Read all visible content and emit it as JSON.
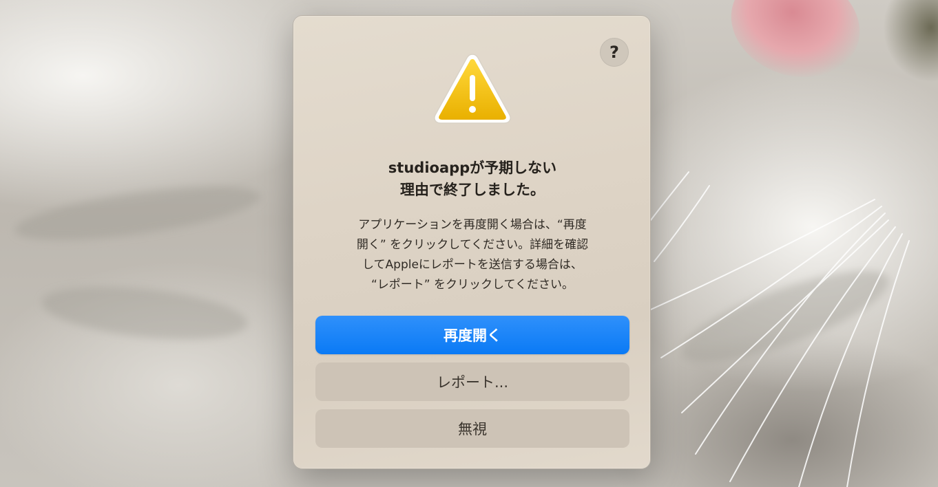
{
  "dialog": {
    "help_label": "?",
    "title_line1": "studioappが予期しない",
    "title_line2": "理由で終了しました。",
    "message_lines": [
      "アプリケーションを再度開く場合は、“再度",
      "開く” をクリックしてください。詳細を確認",
      "してAppleにレポートを送信する場合は、",
      "“レポート” をクリックしてください。"
    ],
    "buttons": {
      "reopen": "再度開く",
      "report": "レポート...",
      "ignore": "無視"
    }
  },
  "icons": {
    "warning": "warning-triangle-icon",
    "help": "question-mark-icon"
  },
  "colors": {
    "primary_button": "#0a7af5",
    "warning_yellow": "#f2c100",
    "dialog_background": "#ded4c6"
  }
}
